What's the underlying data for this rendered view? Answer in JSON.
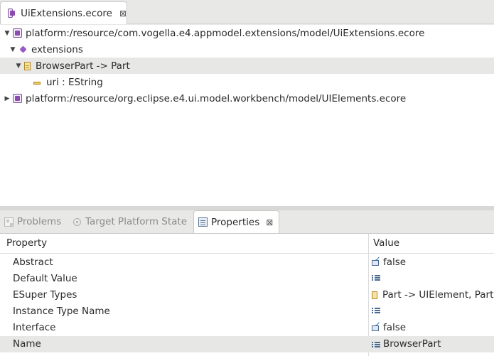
{
  "editor": {
    "tab_title": "UiExtensions.ecore",
    "tree": [
      {
        "label": "platform:/resource/com.vogella.e4.appmodel.extensions/model/UiExtensions.ecore",
        "icon": "ecore-resource-icon"
      },
      {
        "label": "extensions",
        "icon": "epackage-icon"
      },
      {
        "label": "BrowserPart -> Part",
        "icon": "eclass-icon"
      },
      {
        "label": "uri : EString",
        "icon": "eattribute-icon"
      },
      {
        "label": "platform:/resource/org.eclipse.e4.ui.model.workbench/model/UIElements.ecore",
        "icon": "ecore-resource-icon"
      }
    ]
  },
  "views": {
    "tabs": [
      {
        "label": "Problems",
        "icon": "problems-icon"
      },
      {
        "label": "Target Platform State",
        "icon": "target-icon"
      },
      {
        "label": "Properties",
        "icon": "properties-icon"
      }
    ],
    "properties": {
      "col_property": "Property",
      "col_value": "Value",
      "rows": [
        {
          "name": "Abstract",
          "value": "false",
          "icon": "boolean-value-icon"
        },
        {
          "name": "Default Value",
          "value": "",
          "icon": "text-value-icon"
        },
        {
          "name": "ESuper Types",
          "value": "Part -> UIElement, PartS",
          "icon": "eclass-icon"
        },
        {
          "name": "Instance Type Name",
          "value": "",
          "icon": "text-value-icon"
        },
        {
          "name": "Interface",
          "value": "false",
          "icon": "boolean-value-icon"
        },
        {
          "name": "Name",
          "value": "BrowserPart",
          "icon": "text-value-icon"
        }
      ]
    }
  }
}
